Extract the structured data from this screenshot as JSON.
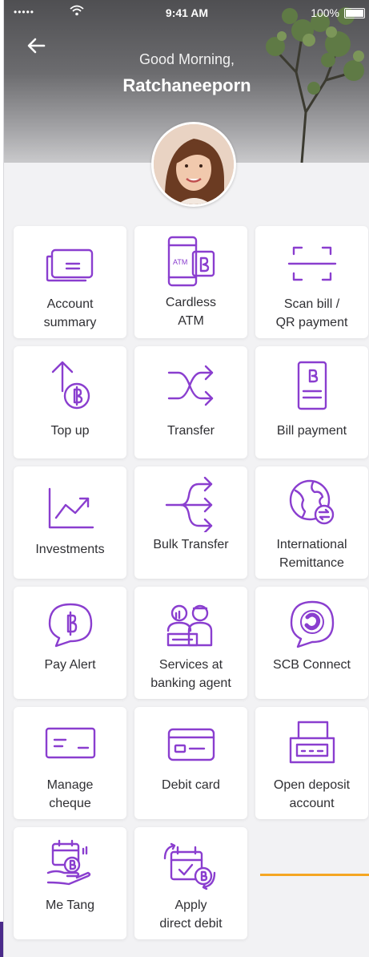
{
  "status_bar": {
    "signal": "•••••",
    "time": "9:41 AM",
    "battery": "100%"
  },
  "header": {
    "greeting": "Good Morning,",
    "user_name": "Ratchaneeporn"
  },
  "colors": {
    "accent": "#8a3ecf",
    "highlight_line": "#f5a623"
  },
  "menu": [
    {
      "label": "Account\nsummary",
      "icon": "account-summary-icon"
    },
    {
      "label": "Cardless\nATM",
      "icon": "cardless-atm-icon",
      "atm_text": "ATM"
    },
    {
      "label": "Scan bill /\nQR payment",
      "icon": "scan-icon"
    },
    {
      "label": "Top up",
      "icon": "top-up-icon"
    },
    {
      "label": "Transfer",
      "icon": "transfer-icon"
    },
    {
      "label": "Bill payment",
      "icon": "bill-payment-icon"
    },
    {
      "label": "Investments",
      "icon": "investments-icon"
    },
    {
      "label": "Bulk Transfer",
      "icon": "bulk-transfer-icon"
    },
    {
      "label": "International\nRemittance",
      "icon": "globe-icon"
    },
    {
      "label": "Pay Alert",
      "icon": "pay-alert-icon"
    },
    {
      "label": "Services at\nbanking agent",
      "icon": "banking-agent-icon"
    },
    {
      "label": "SCB Connect",
      "icon": "scb-connect-icon"
    },
    {
      "label": "Manage\ncheque",
      "icon": "cheque-icon"
    },
    {
      "label": "Debit card",
      "icon": "debit-card-icon"
    },
    {
      "label": "Open deposit\naccount",
      "icon": "deposit-account-icon"
    },
    {
      "label": "Me Tang",
      "icon": "me-tang-icon"
    },
    {
      "label": "Apply\ndirect debit",
      "icon": "direct-debit-icon"
    }
  ]
}
